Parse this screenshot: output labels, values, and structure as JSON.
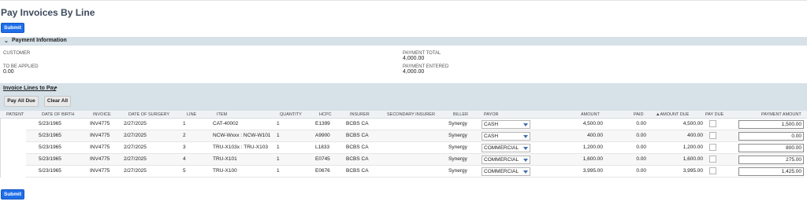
{
  "page": {
    "title": "Pay Invoices By Line",
    "submit_label": "Submit"
  },
  "payment_info": {
    "section_label": "Payment Information",
    "customer_label": "CUSTOMER",
    "customer_value": "",
    "to_be_applied_label": "TO BE APPLIED",
    "to_be_applied_value": "0.00",
    "payment_total_label": "PAYMENT TOTAL",
    "payment_total_value": "4,000.00",
    "payment_entered_label": "PAYMENT ENTERED",
    "payment_entered_value": "4,000.00"
  },
  "invoice_lines": {
    "section_label": "Invoice Lines to Pay",
    "required_marker": "•",
    "pay_all_due_label": "Pay All Due",
    "clear_all_label": "Clear All",
    "columns": {
      "patient": "PATIENT",
      "dob": "DATE OF BIRTH",
      "invoice": "INVOICE",
      "surgery": "DATE OF SURGERY",
      "line": "LINE",
      "item": "ITEM",
      "quantity": "QUANTITY",
      "hcpc": "HCPC",
      "insurer": "INSURER",
      "secondary": "SECONDARY INSURER",
      "biller": "BILLER",
      "payor": "PAYOR",
      "amount": "AMOUNT",
      "paid": "PAID",
      "amount_due": "▲AMOUNT DUE",
      "pay_due": "PAY DUE",
      "payment_amount": "PAYMENT AMOUNT"
    },
    "rows": [
      {
        "dob": "5/23/1965",
        "invoice": "INV4775",
        "surgery": "2/27/2025",
        "line": "1",
        "item": "CAT-40002",
        "quantity": "1",
        "hcpc": "E1399",
        "insurer": "BCBS CA",
        "biller": "Synergy",
        "payor": "CASH",
        "amount": "4,500.00",
        "paid": "0.00",
        "amount_due": "4,500.00",
        "payment_amount": "1,500.00"
      },
      {
        "dob": "5/23/1965",
        "invoice": "INV4775",
        "surgery": "2/27/2025",
        "line": "2",
        "item": "NCW-Wxxx : NCW-W101",
        "quantity": "1",
        "hcpc": "A9900",
        "insurer": "BCBS CA",
        "biller": "Synergy",
        "payor": "CASH",
        "amount": "400.00",
        "paid": "0.00",
        "amount_due": "400.00",
        "payment_amount": "0.00"
      },
      {
        "dob": "5/23/1965",
        "invoice": "INV4775",
        "surgery": "2/27/2025",
        "line": "3",
        "item": "TRU-X103x : TRU-X103",
        "quantity": "1",
        "hcpc": "L1833",
        "insurer": "BCBS CA",
        "biller": "Synergy",
        "payor": "COMMERCIAL",
        "amount": "1,200.00",
        "paid": "0.00",
        "amount_due": "1,200.00",
        "payment_amount": "800.00"
      },
      {
        "dob": "5/23/1965",
        "invoice": "INV4775",
        "surgery": "2/27/2025",
        "line": "4",
        "item": "TRU-X101",
        "quantity": "1",
        "hcpc": "E0745",
        "insurer": "BCBS CA",
        "biller": "Synergy",
        "payor": "COMMERCIAL",
        "amount": "1,600.00",
        "paid": "0.00",
        "amount_due": "1,600.00",
        "payment_amount": "275.00"
      },
      {
        "dob": "5/23/1965",
        "invoice": "INV4775",
        "surgery": "2/27/2025",
        "line": "5",
        "item": "TRU-X100",
        "quantity": "1",
        "hcpc": "E0676",
        "insurer": "BCBS CA",
        "biller": "Synergy",
        "payor": "COMMERCIAL",
        "amount": "3,995.00",
        "paid": "0.00",
        "amount_due": "3,995.00",
        "payment_amount": "1,425.00"
      }
    ]
  },
  "colors": {
    "accent": "#1f6ee8",
    "section_bar": "#d6e1e8",
    "title": "#3c4a5c"
  }
}
